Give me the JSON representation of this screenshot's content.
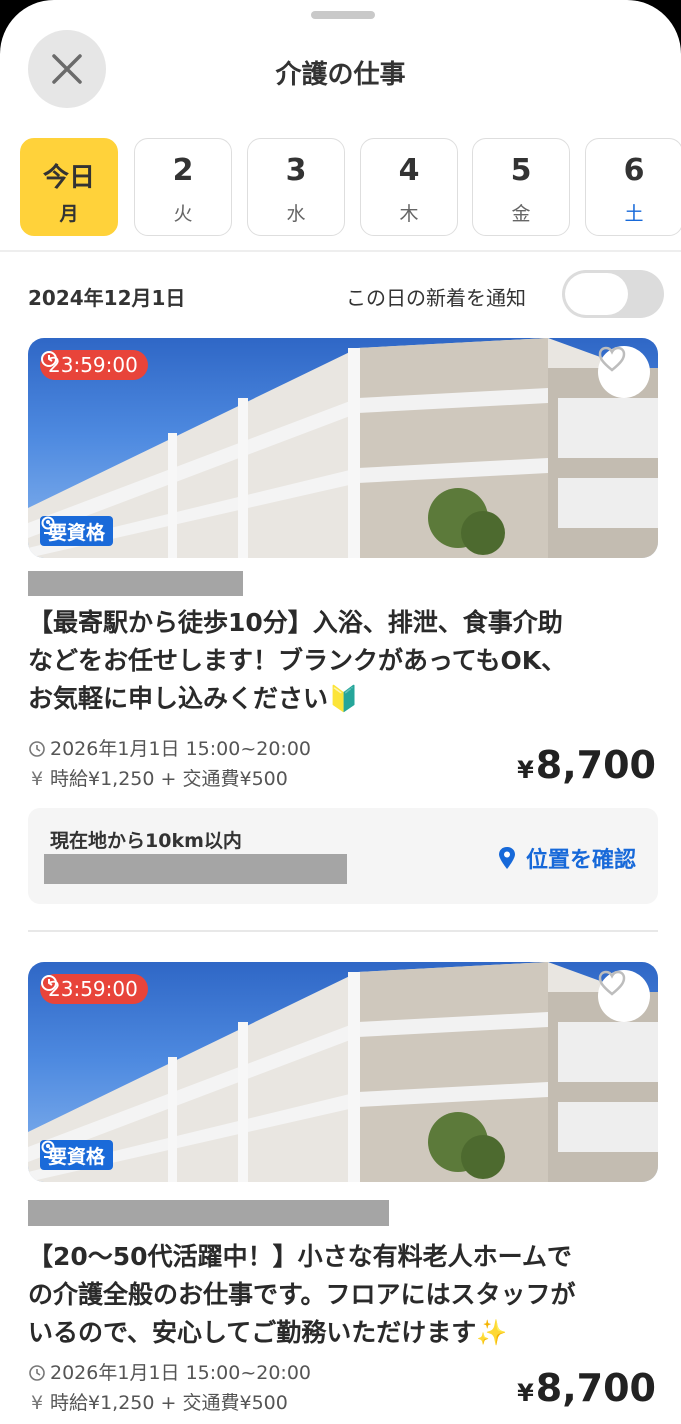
{
  "header": {
    "title": "介護の仕事"
  },
  "icons": {
    "close": "close-icon",
    "clock": "clock-icon",
    "heart": "heart-icon",
    "qualification": "person-badge-icon",
    "location": "location-pin-icon",
    "yen": "yen-icon"
  },
  "colors": {
    "accent_yellow": "#ffd23a",
    "timer_red": "#e8443a",
    "badge_blue": "#1a6ad9",
    "link_blue": "#1769d9"
  },
  "days": [
    {
      "num": "今日",
      "weekday": "月",
      "active": true
    },
    {
      "num": "2",
      "weekday": "火"
    },
    {
      "num": "3",
      "weekday": "水"
    },
    {
      "num": "4",
      "weekday": "木"
    },
    {
      "num": "5",
      "weekday": "金"
    },
    {
      "num": "6",
      "weekday": "土",
      "saturday": true
    }
  ],
  "date_label": "2024年12月1日",
  "notify": {
    "label": "この日の新着を通知",
    "enabled": false
  },
  "jobs": [
    {
      "timer": "23:59:00",
      "badge": "要資格",
      "title_lines": [
        "【最寄駅から徒歩10分】入浴、排泄、食事介助",
        "などをお任せします！ブランクがあってもOK、",
        "お気軽に申し込みください🔰"
      ],
      "datetime": "2026年1月1日 15:00~20:00",
      "wage": "時給¥1,250 + 交通費¥500",
      "price": "8,700",
      "currency": "¥",
      "distance": "現在地から10km以内",
      "location_button": "位置を確認"
    },
    {
      "timer": "23:59:00",
      "badge": "要資格",
      "title_lines": [
        "【20〜50代活躍中！】小さな有料老人ホームで",
        "の介護全般のお仕事です。フロアにはスタッフが",
        "いるので、安心してご勤務いただけます✨"
      ],
      "datetime": "2026年1月1日 15:00~20:00",
      "wage": "時給¥1,250 + 交通費¥500",
      "price": "8,700",
      "currency": "¥"
    }
  ]
}
